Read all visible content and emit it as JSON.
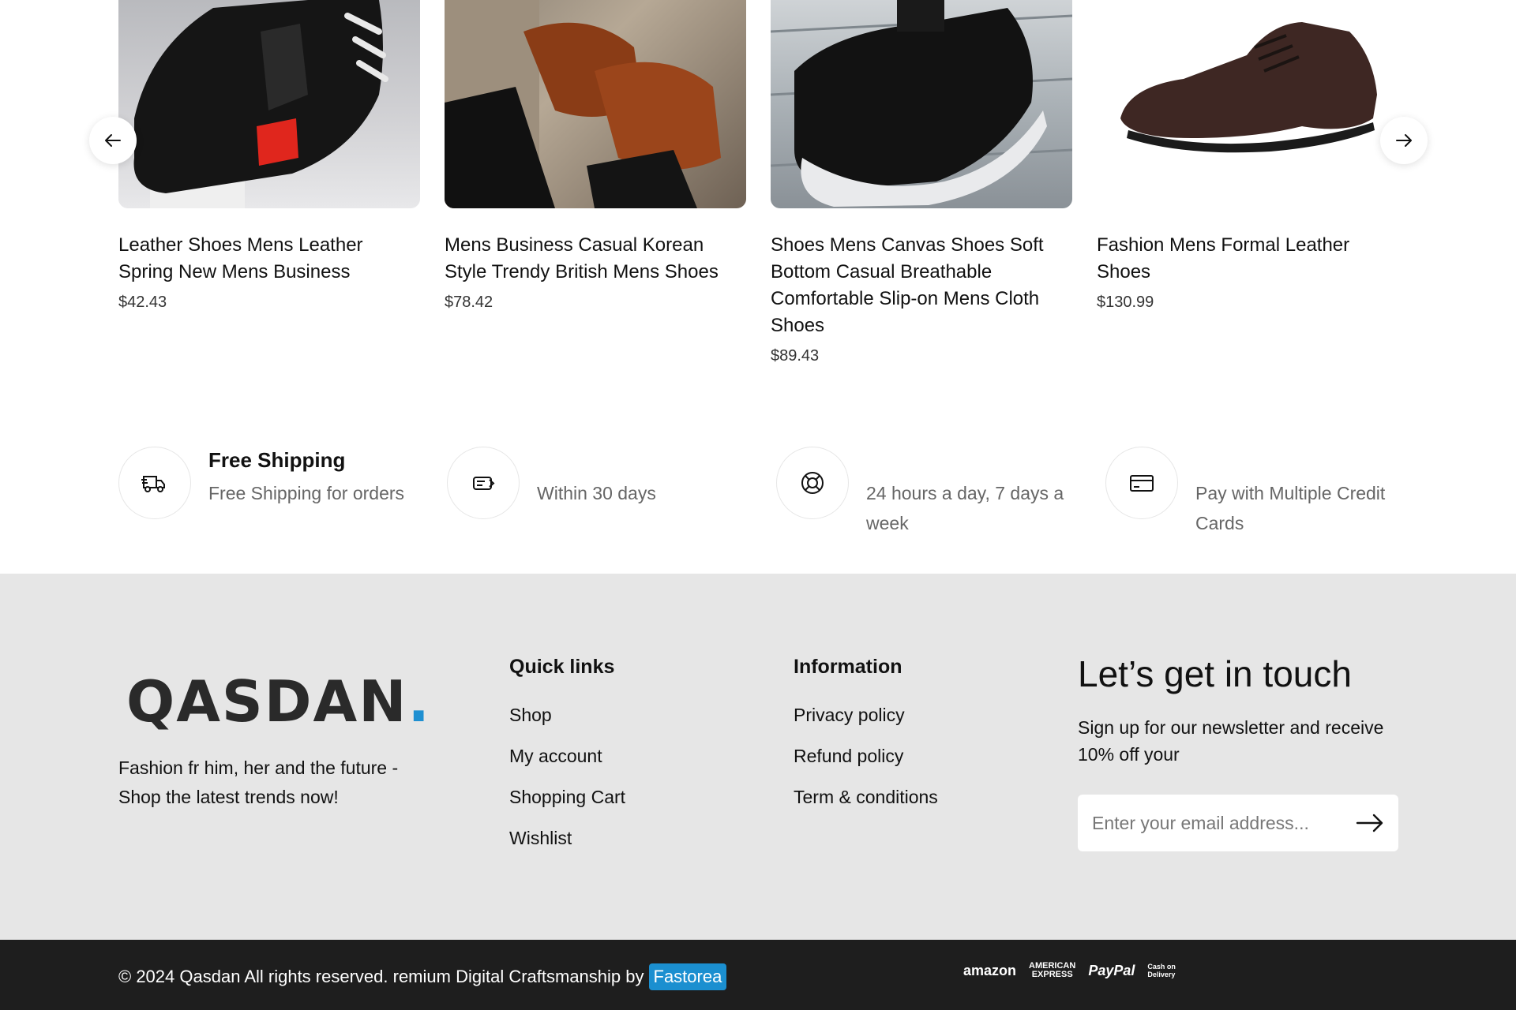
{
  "carousel": {
    "products": [
      {
        "name": "Leather Shoes Mens Leather Spring New Mens Business",
        "price": "$42.43"
      },
      {
        "name": "Mens Business Casual Korean Style Trendy British Mens Shoes",
        "price": "$78.42"
      },
      {
        "name": "Shoes Mens Canvas Shoes Soft Bottom Casual Breathable Comfortable Slip-on Mens Cloth Shoes",
        "price": "$89.43"
      },
      {
        "name": "Fashion Mens Formal Leather Shoes",
        "price": "$130.99"
      }
    ],
    "prev_icon": "arrow-left-icon",
    "next_icon": "arrow-right-icon"
  },
  "features": [
    {
      "title": "Free Shipping",
      "desc": "Free Shipping for orders",
      "icon": "delivery-truck-icon"
    },
    {
      "title": "",
      "desc": "Within 30 days",
      "icon": "return-money-icon"
    },
    {
      "title": "",
      "desc": "24 hours a day, 7 days a week",
      "icon": "support-lifebuoy-icon"
    },
    {
      "title": "",
      "desc": "Pay with Multiple Credit Cards",
      "icon": "credit-card-icon"
    }
  ],
  "footer": {
    "logo_text": "QASDAN",
    "logo_dot": ".",
    "tagline": "Fashion fr him, her and the future - Shop the latest trends now!",
    "quick_links": {
      "title": "Quick links",
      "items": [
        "Shop",
        "My account",
        "Shopping Cart",
        "Wishlist"
      ]
    },
    "information": {
      "title": "Information",
      "items": [
        "Privacy policy",
        "Refund policy",
        "Term & conditions"
      ]
    },
    "newsletter": {
      "title": "Let’s get in touch",
      "text": "Sign up for our newsletter and receive 10% off your",
      "placeholder": "Enter your email address..."
    }
  },
  "bottom": {
    "copyright": "© 2024 Qasdan All rights reserved. remium Digital Craftsmanship by",
    "badge": "Fastorea",
    "payments": {
      "amazon": "amazon",
      "amex_line1": "AMERICAN",
      "amex_line2": "EXPRESS",
      "paypal": "PayPal",
      "cod_line1": "Cash on",
      "cod_line2": "Delivery"
    }
  },
  "colors": {
    "footer_bg": "#e6e6e6",
    "bottom_bg": "#1e1e1e",
    "accent": "#1b8fd0"
  }
}
